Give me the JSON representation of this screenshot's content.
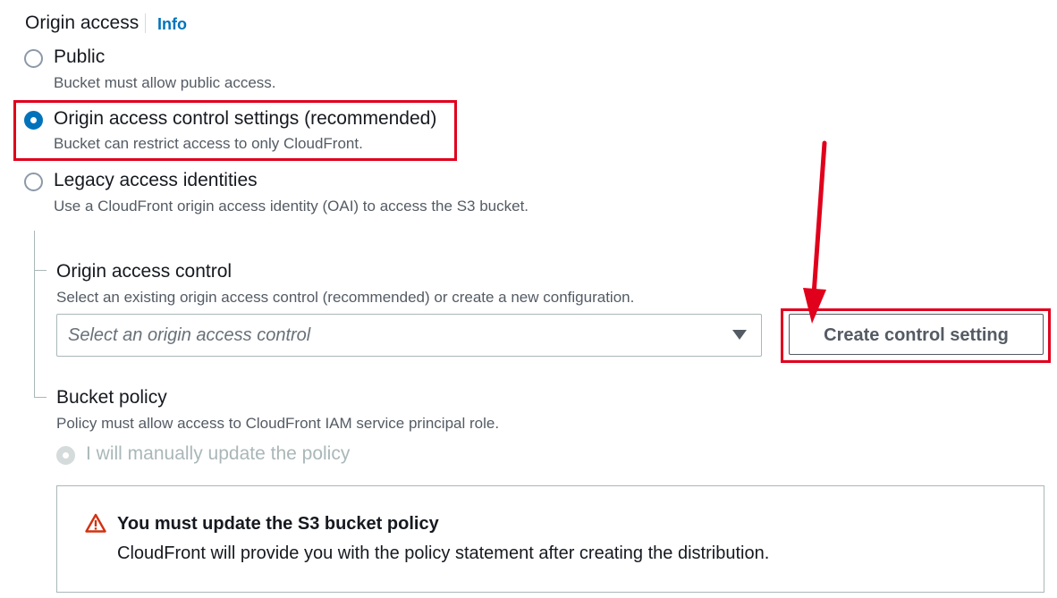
{
  "section": {
    "title": "Origin access",
    "info_link": "Info"
  },
  "origin_access_options": [
    {
      "label": "Public",
      "description": "Bucket must allow public access.",
      "selected": false
    },
    {
      "label": "Origin access control settings (recommended)",
      "description": "Bucket can restrict access to only CloudFront.",
      "selected": true
    },
    {
      "label": "Legacy access identities",
      "description": "Use a CloudFront origin access identity (OAI) to access the S3 bucket.",
      "selected": false
    }
  ],
  "origin_access_control": {
    "label": "Origin access control",
    "description": "Select an existing origin access control (recommended) or create a new configuration.",
    "select_placeholder": "Select an origin access control",
    "create_button_label": "Create control setting"
  },
  "bucket_policy": {
    "label": "Bucket policy",
    "description": "Policy must allow access to CloudFront IAM service principal role.",
    "option_label": "I will manually update the policy",
    "option_disabled": true
  },
  "alert": {
    "icon": "warning-icon",
    "title": "You must update the S3 bucket policy",
    "text": "CloudFront will provide you with the policy statement after creating the distribution."
  },
  "colors": {
    "link": "#0073bb",
    "radio_selected": "#0073bb",
    "annotation_red": "#e0001b",
    "warning": "#d13212"
  }
}
